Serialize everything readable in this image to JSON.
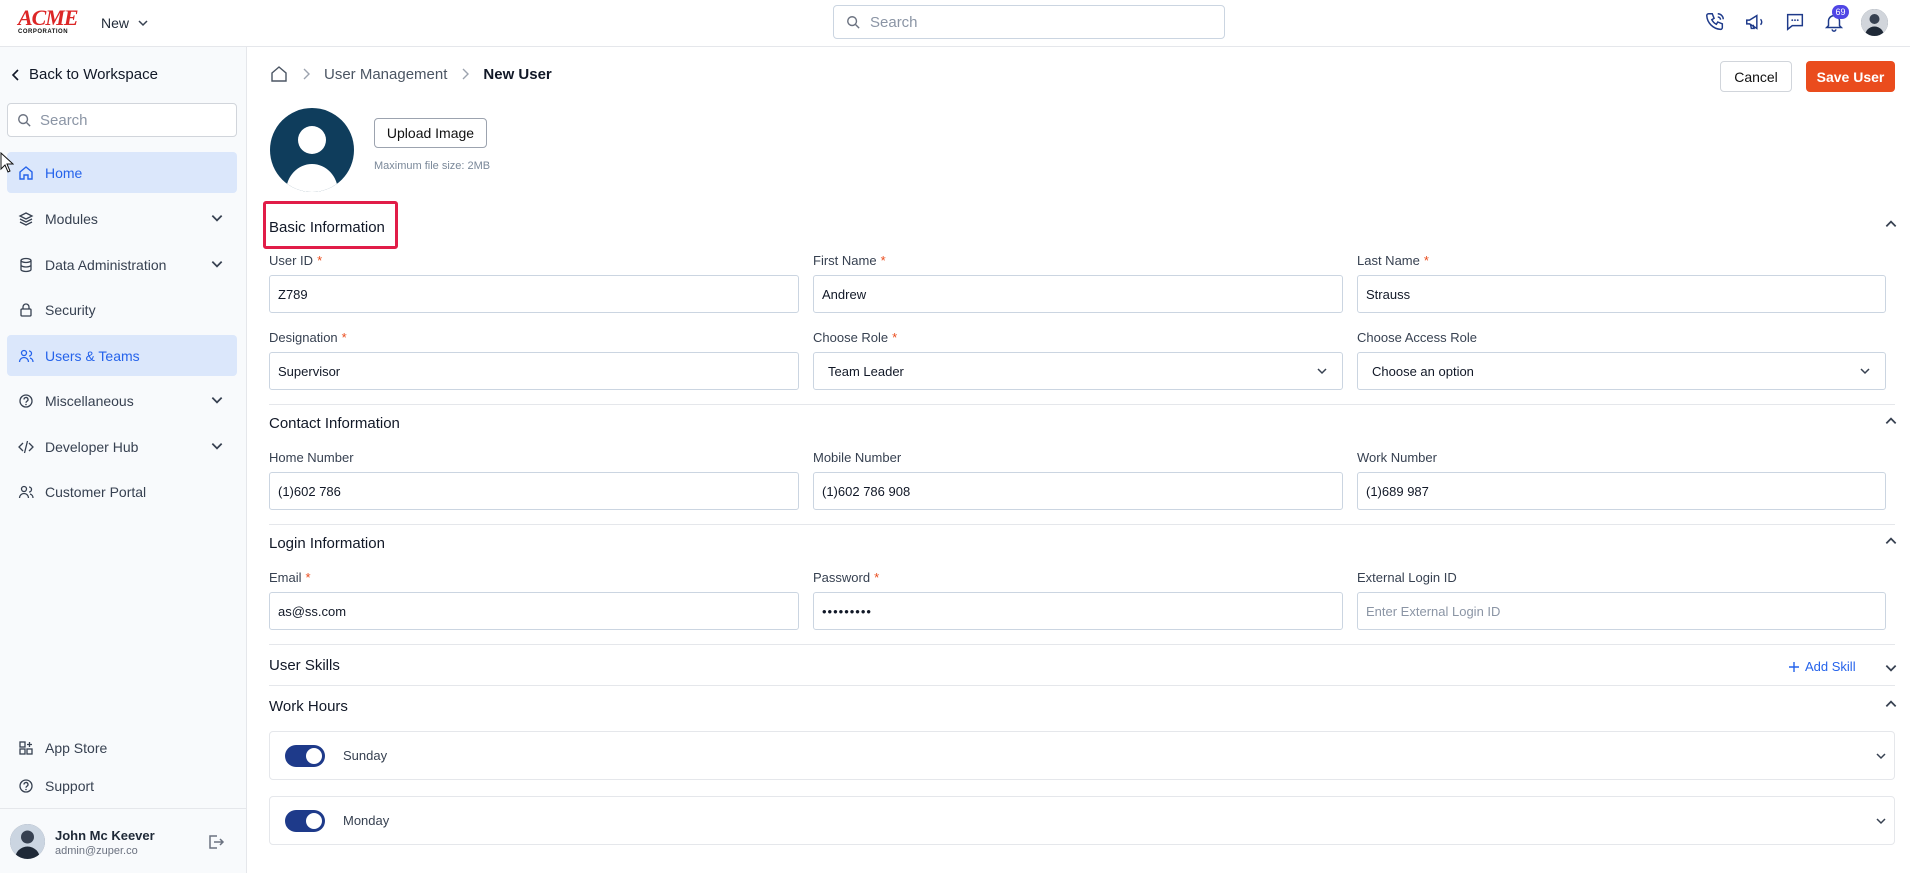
{
  "brand": {
    "logo_text": "ACME",
    "logo_sub": "CORPORATION",
    "new_label": "New"
  },
  "top_search": {
    "placeholder": "Search"
  },
  "notifications": {
    "count": "69"
  },
  "sidebar": {
    "back_label": "Back to Workspace",
    "search_placeholder": "Search",
    "items": [
      {
        "label": "Home",
        "icon": "home-icon",
        "active": true
      },
      {
        "label": "Modules",
        "icon": "layers-icon",
        "expandable": true
      },
      {
        "label": "Data Administration",
        "icon": "database-icon",
        "expandable": true
      },
      {
        "label": "Security",
        "icon": "lock-icon"
      },
      {
        "label": "Users & Teams",
        "icon": "users-icon",
        "active": true
      },
      {
        "label": "Miscellaneous",
        "icon": "help-circle-icon",
        "expandable": true
      },
      {
        "label": "Developer Hub",
        "icon": "code-icon",
        "expandable": true
      },
      {
        "label": "Customer Portal",
        "icon": "users-icon"
      }
    ],
    "bottom_items": [
      {
        "label": "App Store",
        "icon": "grid-plus-icon"
      },
      {
        "label": "Support",
        "icon": "help-circle-icon"
      }
    ],
    "user": {
      "name": "John Mc Keever",
      "email": "admin@zuper.co"
    }
  },
  "breadcrumb": {
    "parent": "User Management",
    "current": "New User"
  },
  "actions": {
    "cancel": "Cancel",
    "save": "Save User"
  },
  "profile": {
    "upload_label": "Upload Image",
    "hint": "Maximum file size: 2MB"
  },
  "sections": {
    "basic": {
      "title": "Basic Information",
      "user_id": {
        "label": "User ID",
        "value": "Z789"
      },
      "first_name": {
        "label": "First Name",
        "value": "Andrew"
      },
      "last_name": {
        "label": "Last Name",
        "value": "Strauss"
      },
      "designation": {
        "label": "Designation",
        "value": "Supervisor"
      },
      "role": {
        "label": "Choose Role",
        "value": "Team Leader"
      },
      "access_role": {
        "label": "Choose Access Role",
        "value": "Choose an option"
      }
    },
    "contact": {
      "title": "Contact Information",
      "home": {
        "label": "Home Number",
        "value": "(1)602 786"
      },
      "mobile": {
        "label": "Mobile Number",
        "value": "(1)602 786 908"
      },
      "work": {
        "label": "Work Number",
        "value": "(1)689 987"
      }
    },
    "login": {
      "title": "Login Information",
      "email": {
        "label": "Email",
        "value": "as@ss.com"
      },
      "password": {
        "label": "Password",
        "value": "•••••••••"
      },
      "external": {
        "label": "External Login ID",
        "placeholder": "Enter External Login ID"
      }
    },
    "skills": {
      "title": "User Skills",
      "add_label": "Add Skill"
    },
    "work_hours": {
      "title": "Work Hours",
      "days": [
        {
          "label": "Sunday",
          "enabled": true
        },
        {
          "label": "Monday",
          "enabled": true
        }
      ]
    }
  },
  "required_mark": "*",
  "colors": {
    "accent": "#ea4c1d",
    "active_nav_bg": "#dbe7fb",
    "link": "#2563eb",
    "toggle": "#1e3a8a",
    "highlight": "#e11d48"
  }
}
